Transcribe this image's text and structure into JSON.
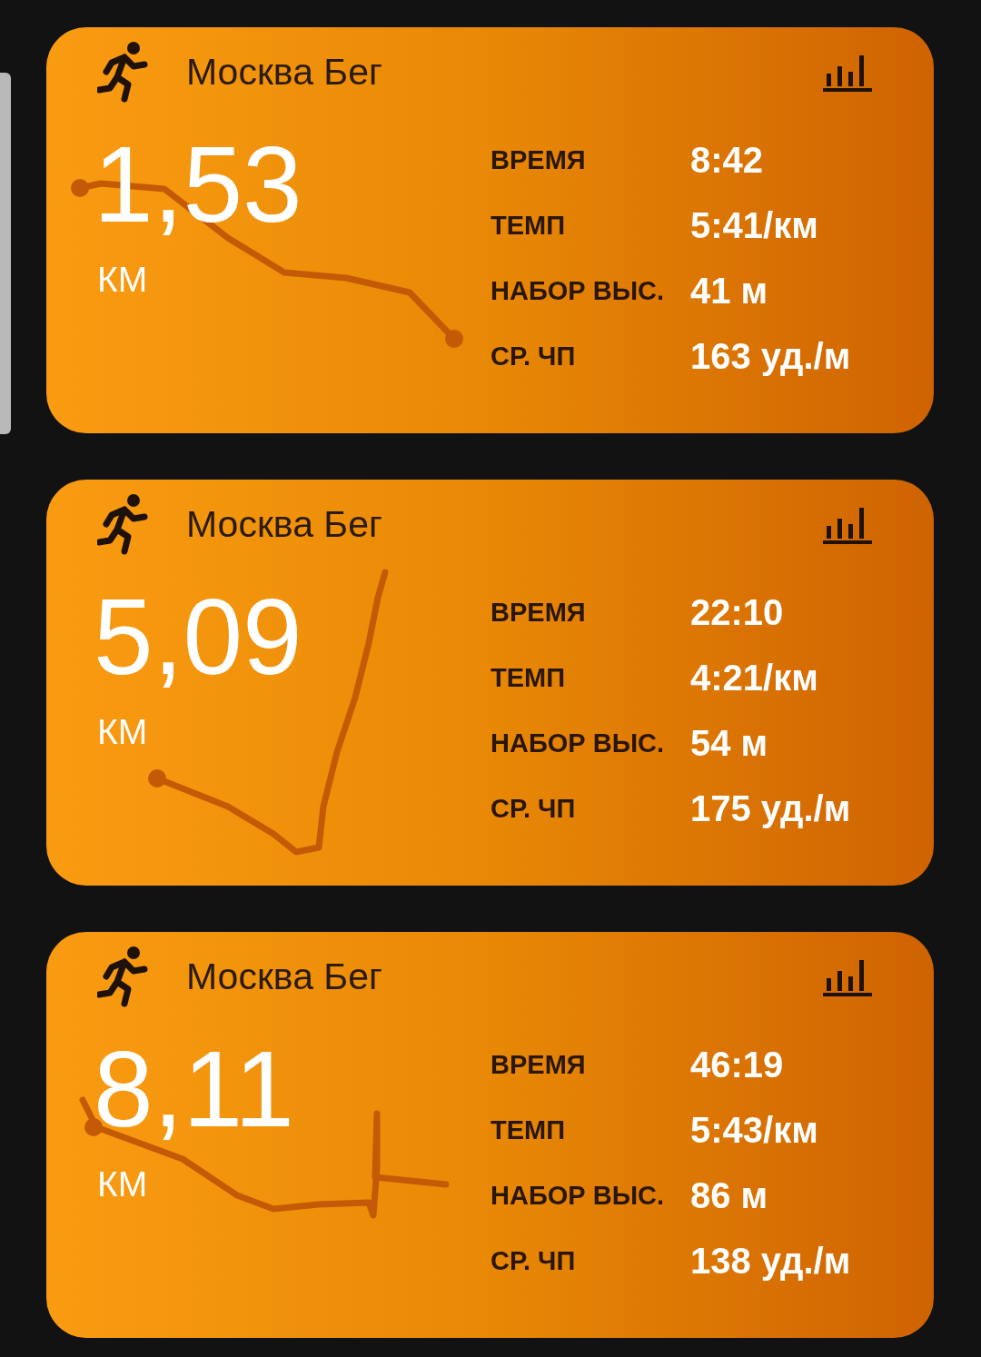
{
  "activities": [
    {
      "title": "Москва Бег",
      "distance": "1,53",
      "unit": "КМ",
      "stats": [
        {
          "label": "ВРЕМЯ",
          "value": "8:42"
        },
        {
          "label": "ТЕМП",
          "value": "5:41/км"
        },
        {
          "label": "НАБОР ВЫС.",
          "value": "41 м"
        },
        {
          "label": "СР. ЧП",
          "value": "163 уд./м"
        }
      ]
    },
    {
      "title": "Москва Бег",
      "distance": "5,09",
      "unit": "КМ",
      "stats": [
        {
          "label": "ВРЕМЯ",
          "value": "22:10"
        },
        {
          "label": "ТЕМП",
          "value": "4:21/км"
        },
        {
          "label": "НАБОР ВЫС.",
          "value": "54 м"
        },
        {
          "label": "СР. ЧП",
          "value": "175 уд./м"
        }
      ]
    },
    {
      "title": "Москва Бег",
      "distance": "8,11",
      "unit": "КМ",
      "stats": [
        {
          "label": "ВРЕМЯ",
          "value": "46:19"
        },
        {
          "label": "ТЕМП",
          "value": "5:43/км"
        },
        {
          "label": "НАБОР ВЫС.",
          "value": "86 м"
        },
        {
          "label": "СР. ЧП",
          "value": "138 уд./м"
        }
      ]
    }
  ]
}
